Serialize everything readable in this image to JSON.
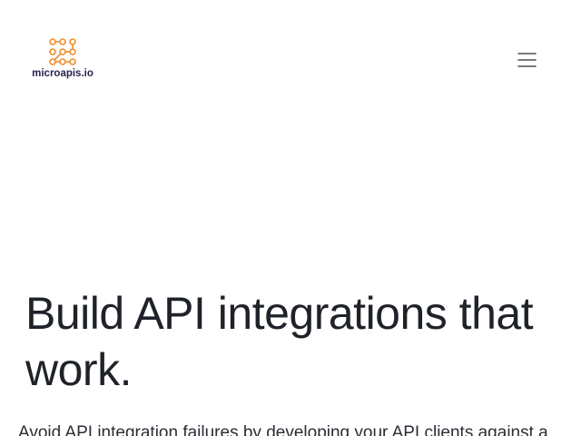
{
  "header": {
    "logo": {
      "text": "microapis.io",
      "icon": "network-dots-icon",
      "icon_color": "#f08c2e",
      "text_color": "#2b2250"
    },
    "menu": {
      "icon": "hamburger-menu-icon"
    }
  },
  "hero": {
    "title": "Build API integrations that work.",
    "subtitle": "Avoid API integration failures by developing your API clients against a"
  },
  "colors": {
    "background": "#ffffff",
    "heading": "#1f2329",
    "menu_icon": "#4a4f57"
  }
}
